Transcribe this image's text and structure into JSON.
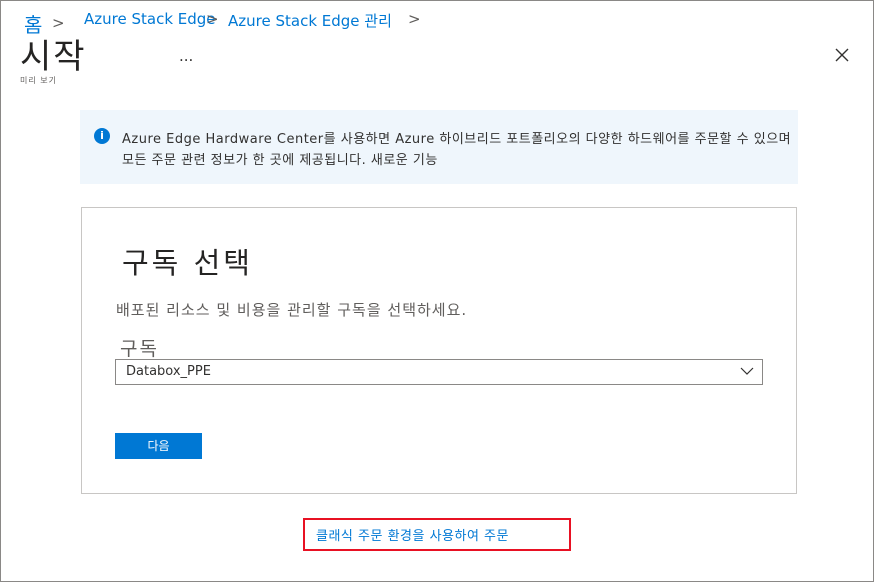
{
  "breadcrumb": {
    "home": "홈",
    "separator": ">",
    "item1": "Azure Stack Edge",
    "item2": "Azure Stack Edge 관리"
  },
  "header": {
    "title": "시작",
    "subtitle": "미리 보기",
    "more": "..."
  },
  "banner": {
    "icon": "info-icon",
    "line1": "Azure Edge Hardware Center를 사용하면 Azure 하이브리드 포트폴리오의 다양한 하드웨어를 주문할 수 있으며",
    "line2": "모든 주문 관련 정보가 한 곳에 제공됩니다. 새로운 기능"
  },
  "card": {
    "title": "구독 선택",
    "description": "배포된 리소스 및 비용을 관리할 구독을 선택하세요.",
    "field_label": "구독",
    "select_value": "Databox_PPE",
    "next_label": "다음"
  },
  "classic_link": "클래식 주문 환경을 사용하여 주문",
  "colors": {
    "accent": "#0078d4",
    "banner_bg": "#eff6fc",
    "highlight": "#e81123"
  }
}
